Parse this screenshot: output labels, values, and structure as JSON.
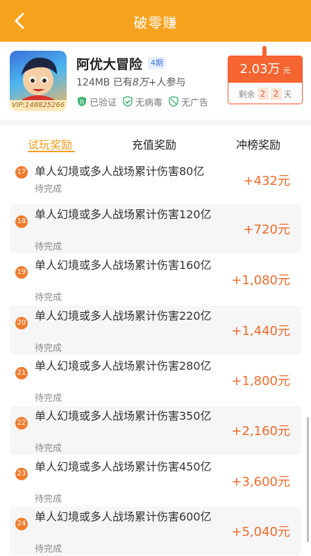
{
  "header": {
    "title": "破零赚"
  },
  "app": {
    "name": "阿优大冒险",
    "issue": "4期",
    "size": "124MB",
    "participants_prefix": "已有",
    "participants_count": "8万+",
    "participants_suffix": "人参与",
    "vip": "VIP:148825266",
    "checks": [
      "已验证",
      "无病毒",
      "无广告"
    ]
  },
  "reward": {
    "amount": "2.03万",
    "unit": "元",
    "remain_label": "剩余",
    "days_digit1": "2",
    "days_digit2": "2",
    "days_unit": "天"
  },
  "tabs": [
    "试玩奖励",
    "充值奖励",
    "冲榜奖励"
  ],
  "tasks": [
    {
      "num": "17",
      "title": "单人幻境或多人战场累计伤害80亿",
      "status": "待完成",
      "reward": "+432元"
    },
    {
      "num": "18",
      "title": "单人幻境或多人战场累计伤害120亿",
      "status": "待完成",
      "reward": "+720元"
    },
    {
      "num": "19",
      "title": "单人幻境或多人战场累计伤害160亿",
      "status": "待完成",
      "reward": "+1,080元"
    },
    {
      "num": "20",
      "title": "单人幻境或多人战场累计伤害220亿",
      "status": "待完成",
      "reward": "+1,440元"
    },
    {
      "num": "21",
      "title": "单人幻境或多人战场累计伤害280亿",
      "status": "待完成",
      "reward": "+1,800元"
    },
    {
      "num": "22",
      "title": "单人幻境或多人战场累计伤害350亿",
      "status": "待完成",
      "reward": "+2,160元"
    },
    {
      "num": "23",
      "title": "单人幻境或多人战场累计伤害450亿",
      "status": "待完成",
      "reward": "+3,600元"
    },
    {
      "num": "24",
      "title": "单人幻境或多人战场累计伤害600亿",
      "status": "待完成",
      "reward": "+5,040元"
    }
  ],
  "colors": {
    "brand": "#f7a21d",
    "reward": "#f26a2b",
    "badge": "#f56531"
  }
}
